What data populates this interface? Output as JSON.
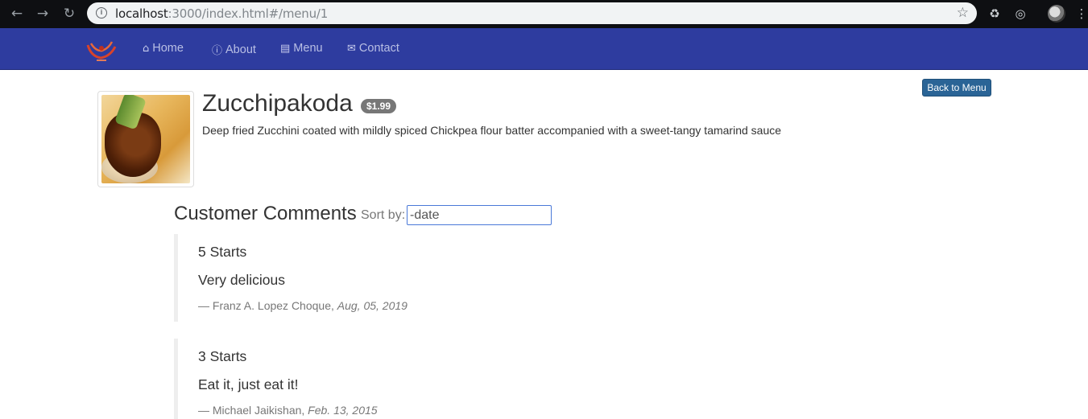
{
  "browser": {
    "url_host": "localhost",
    "url_path": ":3000/index.html#/menu/1"
  },
  "navbar": {
    "items": [
      {
        "label": "Home",
        "icon": "home-icon"
      },
      {
        "label": "About",
        "icon": "info-icon"
      },
      {
        "label": "Menu",
        "icon": "list-icon"
      },
      {
        "label": "Contact",
        "icon": "envelope-icon"
      }
    ]
  },
  "dish": {
    "name": "Zucchipakoda",
    "price": "$1.99",
    "description": "Deep fried Zucchini coated with mildly spiced Chickpea flour batter accompanied with a sweet-tangy tamarind sauce",
    "back_label": "Back to Menu"
  },
  "comments": {
    "heading": "Customer Comments",
    "sort_label": "Sort by:",
    "sort_value": "-date",
    "items": [
      {
        "rating": "5 Starts",
        "text": "Very delicious",
        "author": "— Franz A. Lopez Choque,",
        "date": "Aug, 05, 2019"
      },
      {
        "rating": "3 Starts",
        "text": "Eat it, just eat it!",
        "author": "— Michael Jaikishan,",
        "date": "Feb. 13, 2015"
      }
    ]
  },
  "colors": {
    "navbar": "#2e3c9f",
    "button": "#2a6496",
    "badge": "#777777"
  }
}
